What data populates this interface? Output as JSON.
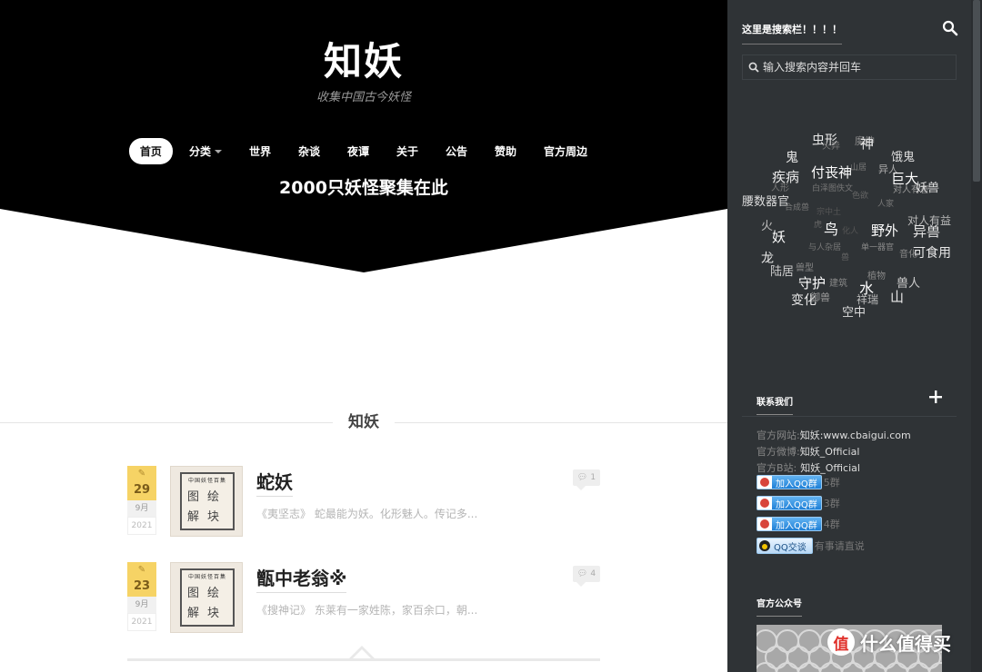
{
  "site": {
    "title": "知妖",
    "description": "收集中国古今妖怪",
    "slogan": "2000只妖怪聚集在此"
  },
  "nav": [
    {
      "label": "首页",
      "active": true
    },
    {
      "label": "分类",
      "dropdown": true
    },
    {
      "label": "世界"
    },
    {
      "label": "杂谈"
    },
    {
      "label": "夜谭"
    },
    {
      "label": "关于"
    },
    {
      "label": "公告"
    },
    {
      "label": "赞助"
    },
    {
      "label": "官方周边"
    }
  ],
  "section": {
    "title": "知妖"
  },
  "posts": [
    {
      "title": "蛇妖",
      "day": "29",
      "month": "9月",
      "year": "2021",
      "comments": "1",
      "excerpt": "《夷坚志》 蛇最能为妖。化形魅人。传记多...",
      "thumb": {
        "caption": "中国妖怪百集",
        "chars": [
          "图",
          "绘",
          "解",
          "块"
        ]
      }
    },
    {
      "title": "甑中老翁※",
      "day": "23",
      "month": "9月",
      "year": "2021",
      "comments": "4",
      "excerpt": "《搜神记》 东莱有一家姓陈，家百余口，朝...",
      "thumb": {
        "caption": "中国妖怪百集",
        "chars": [
          "图",
          "绘",
          "解",
          "块"
        ]
      }
    }
  ],
  "sidebar": {
    "search_heading": "这里是搜索栏！！！！",
    "search_placeholder": "输入搜索内容并回车",
    "tags": [
      {
        "text": "虫形",
        "size": 14,
        "color": "#e8e8e8"
      },
      {
        "text": "魔神",
        "size": 11,
        "color": "#8a8a8a"
      },
      {
        "text": "神",
        "size": 15,
        "color": "#e8e8e8"
      },
      {
        "text": "火异",
        "size": 10,
        "color": "#777777"
      },
      {
        "text": "鬼",
        "size": 14,
        "color": "#e8e8e8"
      },
      {
        "text": "饿鬼",
        "size": 13,
        "color": "#dddddd"
      },
      {
        "text": "付丧神",
        "size": 15,
        "color": "#ffffff"
      },
      {
        "text": "疾病",
        "size": 15,
        "color": "#e8e8e8"
      },
      {
        "text": "异人",
        "size": 11,
        "color": "#aaaaaa"
      },
      {
        "text": "巨大",
        "size": 15,
        "color": "#ffffff"
      },
      {
        "text": "山居",
        "size": 9,
        "color": "#777777"
      },
      {
        "text": "人形",
        "size": 10,
        "color": "#777777"
      },
      {
        "text": "白泽图佚文",
        "size": 9,
        "color": "#777777"
      },
      {
        "text": "对人有害",
        "size": 10,
        "color": "#999999"
      },
      {
        "text": "妖兽",
        "size": 13,
        "color": "#dddddd"
      },
      {
        "text": "腰数器官",
        "size": 13,
        "color": "#dddddd"
      },
      {
        "text": "色欲",
        "size": 9,
        "color": "#666666"
      },
      {
        "text": "人家",
        "size": 9,
        "color": "#777777"
      },
      {
        "text": "合成兽",
        "size": 9,
        "color": "#777777"
      },
      {
        "text": "宗中土",
        "size": 9,
        "color": "#555555"
      },
      {
        "text": "火",
        "size": 13,
        "color": "#bbbbbb"
      },
      {
        "text": "鸟",
        "size": 16,
        "color": "#ffffff"
      },
      {
        "text": "虎",
        "size": 9,
        "color": "#666666"
      },
      {
        "text": "野外",
        "size": 15,
        "color": "#ffffff"
      },
      {
        "text": "对人有益",
        "size": 12,
        "color": "#bbbbbb"
      },
      {
        "text": "异兽",
        "size": 15,
        "color": "#e8e8e8"
      },
      {
        "text": "妖",
        "size": 15,
        "color": "#ffffff"
      },
      {
        "text": "化人",
        "size": 9,
        "color": "#555555"
      },
      {
        "text": "与人杂居",
        "size": 9,
        "color": "#777777"
      },
      {
        "text": "单一器官",
        "size": 9,
        "color": "#888888"
      },
      {
        "text": "音化",
        "size": 10,
        "color": "#888888"
      },
      {
        "text": "可食用",
        "size": 14,
        "color": "#e8e8e8"
      },
      {
        "text": "龙",
        "size": 14,
        "color": "#e8e8e8"
      },
      {
        "text": "兽",
        "size": 9,
        "color": "#666666"
      },
      {
        "text": "陆居",
        "size": 13,
        "color": "#cccccc"
      },
      {
        "text": "兽型",
        "size": 10,
        "color": "#888888"
      },
      {
        "text": "植物",
        "size": 10,
        "color": "#888888"
      },
      {
        "text": "建筑",
        "size": 10,
        "color": "#888888"
      },
      {
        "text": "守护",
        "size": 15,
        "color": "#ffffff"
      },
      {
        "text": "水",
        "size": 16,
        "color": "#ffffff"
      },
      {
        "text": "兽人",
        "size": 13,
        "color": "#cccccc"
      },
      {
        "text": "变化",
        "size": 14,
        "color": "#e8e8e8"
      },
      {
        "text": "御兽",
        "size": 11,
        "color": "#999999"
      },
      {
        "text": "祥瑞",
        "size": 12,
        "color": "#bbbbbb"
      },
      {
        "text": "山",
        "size": 15,
        "color": "#e8e8e8"
      },
      {
        "text": "空中",
        "size": 13,
        "color": "#dddddd"
      }
    ],
    "contact": {
      "heading": "联系我们",
      "lines": [
        {
          "label": "官方网站:",
          "value": "知妖:www.cbaigui.com"
        },
        {
          "label": "官方微博:",
          "value": "知妖_Official"
        },
        {
          "label": "官方B站:",
          "value": "知妖_Official"
        }
      ],
      "qq_groups": [
        {
          "button": "加入QQ群",
          "suffix": "5群"
        },
        {
          "button": "加入QQ群",
          "suffix": "3群"
        },
        {
          "button": "加入QQ群",
          "suffix": "4群"
        }
      ],
      "qq_chat": {
        "button": "QQ交谈",
        "suffix": "有事请直说"
      }
    },
    "wechat": {
      "heading": "官方公众号"
    }
  },
  "watermark": {
    "text": "什么值得买"
  },
  "colors": {
    "hero_bg": "#000000",
    "sidebar_bg": "#2f3336",
    "date_bg": "#f6d365",
    "qq_blue": "#1e7fd6"
  }
}
